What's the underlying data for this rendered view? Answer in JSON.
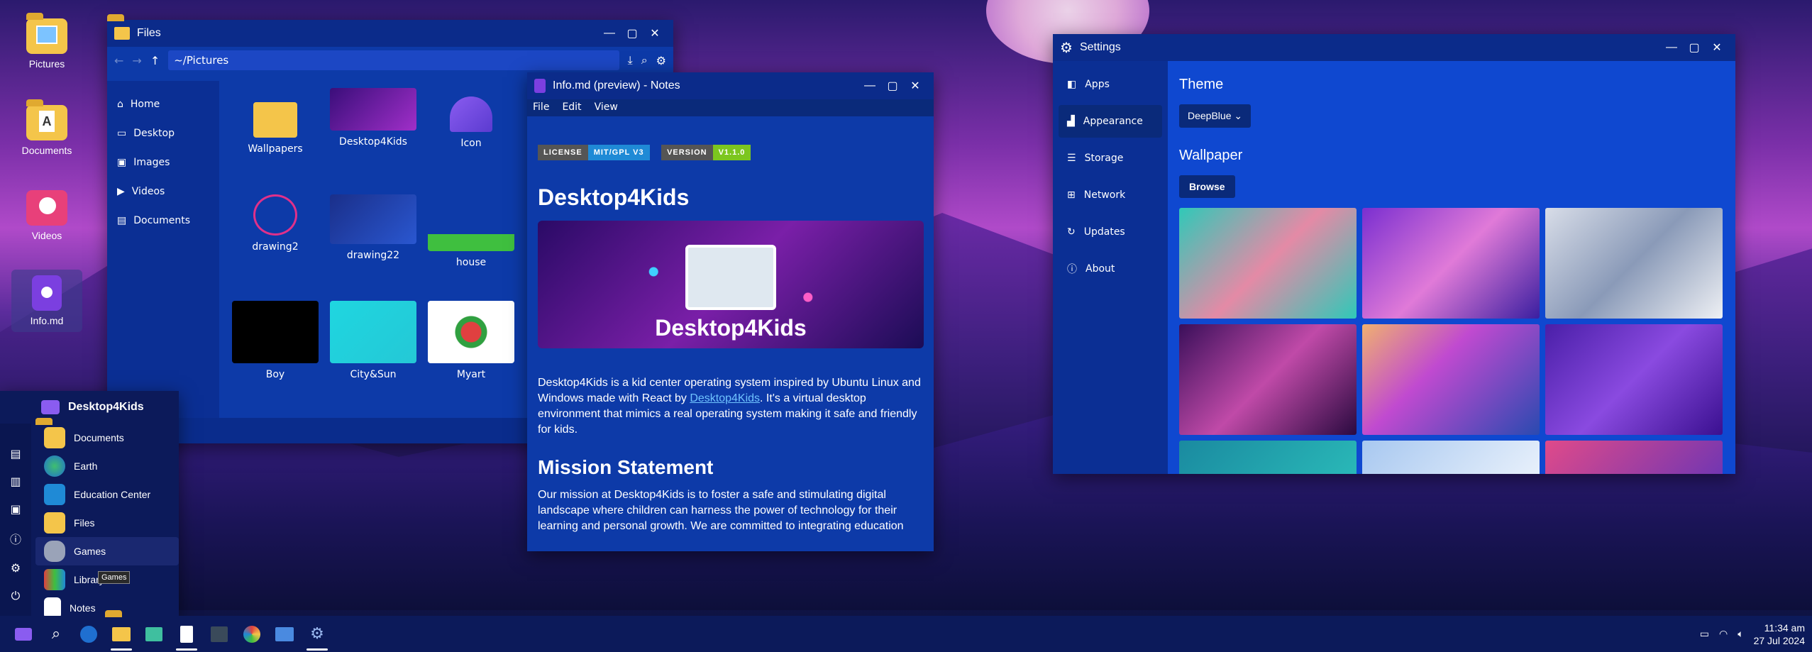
{
  "desktop": {
    "icons": [
      {
        "label": "Pictures"
      },
      {
        "label": "Documents"
      },
      {
        "label": "Videos"
      },
      {
        "label": "Info.md"
      }
    ]
  },
  "files": {
    "title": "Files",
    "path": "~/Pictures",
    "sidebar": [
      {
        "label": "Home"
      },
      {
        "label": "Desktop"
      },
      {
        "label": "Images"
      },
      {
        "label": "Videos"
      },
      {
        "label": "Documents"
      }
    ],
    "items": [
      {
        "label": "Wallpapers"
      },
      {
        "label": "Desktop4Kids"
      },
      {
        "label": "Icon"
      },
      {
        "label": "drawing2"
      },
      {
        "label": "drawing22"
      },
      {
        "label": "house"
      },
      {
        "label": "Boy"
      },
      {
        "label": "City&Sun"
      },
      {
        "label": "Myart"
      }
    ]
  },
  "notes": {
    "title": "Info.md (preview) - Notes",
    "menu": [
      "File",
      "Edit",
      "View"
    ],
    "badges": [
      {
        "key": "LICENSE",
        "value": "MIT/GPL V3",
        "color": "#1f8ad6"
      },
      {
        "key": "VERSION",
        "value": "V1.1.0",
        "color": "#7cc61f"
      }
    ],
    "heading": "Desktop4Kids",
    "banner_text": "Desktop4Kids",
    "intro_pre": "Desktop4Kids is a kid center operating system inspired by Ubuntu Linux and Windows made with React by ",
    "intro_link": "Desktop4Kids",
    "intro_post": ". It's a virtual desktop environment that mimics a real operating system making it safe and friendly for kids.",
    "mission_heading": "Mission Statement",
    "mission_text": "Our mission at Desktop4Kids is to foster a safe and stimulating digital landscape where children can harness the power of technology for their learning and personal growth. We are committed to integrating education"
  },
  "settings": {
    "title": "Settings",
    "sidebar": [
      {
        "label": "Apps"
      },
      {
        "label": "Appearance"
      },
      {
        "label": "Storage"
      },
      {
        "label": "Network"
      },
      {
        "label": "Updates"
      },
      {
        "label": "About"
      }
    ],
    "theme_heading": "Theme",
    "theme_value": "DeepBlue",
    "wallpaper_heading": "Wallpaper",
    "browse_label": "Browse"
  },
  "start_menu": {
    "title": "Desktop4Kids",
    "items": [
      {
        "label": "Documents"
      },
      {
        "label": "Earth"
      },
      {
        "label": "Education Center"
      },
      {
        "label": "Files"
      },
      {
        "label": "Games"
      },
      {
        "label": "Library"
      },
      {
        "label": "Notes"
      }
    ],
    "tooltip": "Games"
  },
  "taskbar": {
    "time": "11:34 am",
    "date": "27 Jul 2024"
  }
}
